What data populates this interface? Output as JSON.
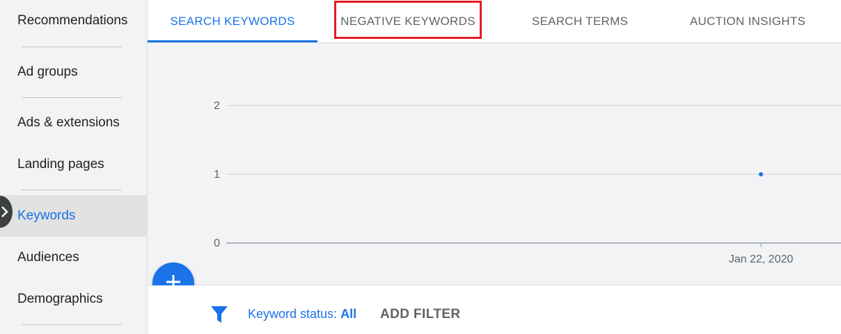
{
  "sidebar": {
    "items": [
      {
        "label": "Recommendations"
      },
      {
        "label": "Ad groups"
      },
      {
        "label": "Ads & extensions"
      },
      {
        "label": "Landing pages"
      },
      {
        "label": "Keywords"
      },
      {
        "label": "Audiences"
      },
      {
        "label": "Demographics"
      }
    ],
    "active_item": "Keywords"
  },
  "tabs": [
    {
      "label": "SEARCH KEYWORDS"
    },
    {
      "label": "NEGATIVE KEYWORDS"
    },
    {
      "label": "SEARCH TERMS"
    },
    {
      "label": "AUCTION INSIGHTS"
    }
  ],
  "active_tab": "SEARCH KEYWORDS",
  "highlighted_tab": "NEGATIVE KEYWORDS",
  "colors": {
    "accent": "#1a73e8",
    "highlight": "#e31b23",
    "sidebar_bg": "#f1f3f4",
    "chart_bg": "#f1f3f4"
  },
  "chart_data": {
    "type": "scatter",
    "x_categories": [
      "Jan 22, 2020"
    ],
    "y_ticks": [
      "0",
      "1",
      "2"
    ],
    "ylim": [
      0,
      2
    ],
    "series": [
      {
        "points": [
          {
            "x": "Jan 22, 2020",
            "y": 1
          }
        ]
      }
    ],
    "grid": true
  },
  "filter": {
    "status_label": "Keyword status:",
    "status_value": "All",
    "add_filter_label": "ADD FILTER"
  },
  "icons": {
    "fab": "plus-icon",
    "filter": "funnel-icon",
    "collapse": "chevron-right-icon"
  }
}
